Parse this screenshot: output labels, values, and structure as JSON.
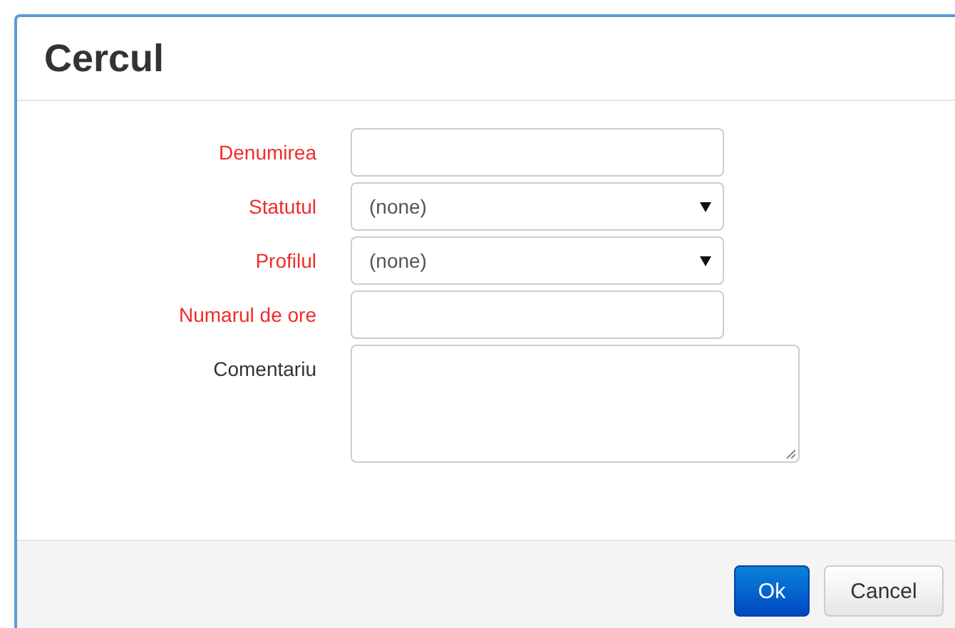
{
  "dialog": {
    "title": "Cercul",
    "fields": [
      {
        "kind": "text",
        "label": "Denumirea",
        "required": true
      },
      {
        "kind": "select",
        "label": "Statutul",
        "required": true,
        "value": "(none)"
      },
      {
        "kind": "select",
        "label": "Profilul",
        "required": true,
        "value": "(none)"
      },
      {
        "kind": "text",
        "label": "Numarul de ore",
        "required": true
      },
      {
        "kind": "textarea",
        "label": "Comentariu",
        "required": false
      }
    ],
    "buttons": [
      {
        "label": "Ok",
        "kind": "primary"
      },
      {
        "label": "Cancel",
        "kind": "default"
      }
    ]
  }
}
